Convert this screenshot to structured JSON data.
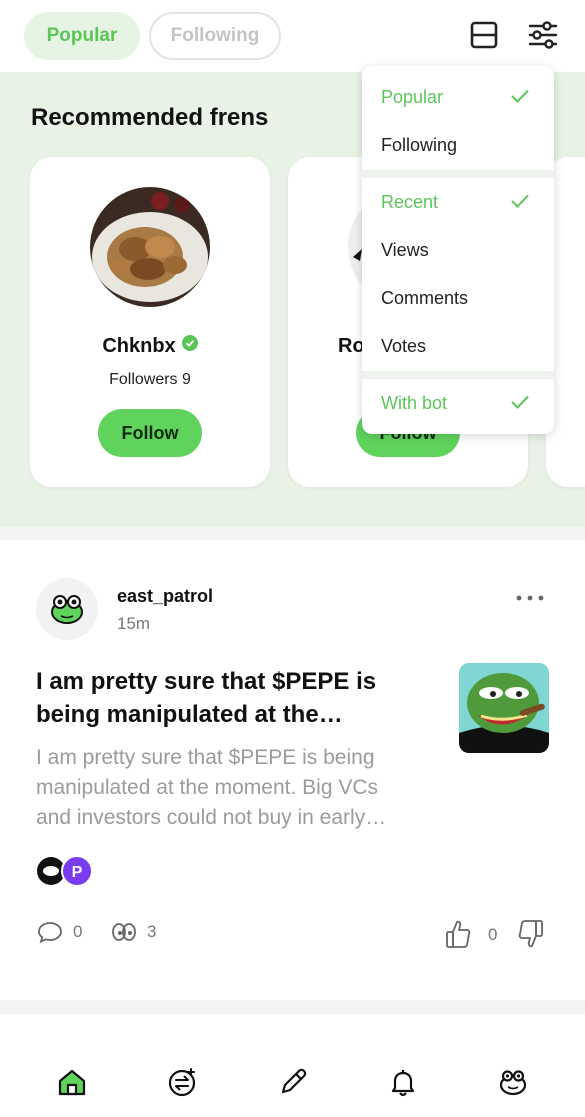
{
  "tabs": {
    "popular": "Popular",
    "following": "Following"
  },
  "icons": {
    "layout": "layout-toggle-icon",
    "filter": "filter-sliders-icon"
  },
  "recommended": {
    "title": "Recommended frens",
    "cards": [
      {
        "name": "Chkn​bx",
        "followers": "Followers 9",
        "button": "Follow",
        "verified": true
      },
      {
        "name": "Ro",
        "button": "Follow"
      }
    ]
  },
  "dropdown": {
    "sort_group": [
      {
        "label": "Popular",
        "selected": true
      },
      {
        "label": "Following",
        "selected": false
      }
    ],
    "order_group": [
      {
        "label": "Recent",
        "selected": true
      },
      {
        "label": "Views",
        "selected": false
      },
      {
        "label": "Comments",
        "selected": false
      },
      {
        "label": "Votes",
        "selected": false
      }
    ],
    "bot_group": [
      {
        "label": "With bot",
        "selected": true
      }
    ]
  },
  "post": {
    "username": "east_patrol",
    "time": "15m",
    "title": "I am pretty sure that $PEPE is being manipulated at the…",
    "body": "I am pretty sure that $PEPE is being manipulated at the moment. Big VCs and investors could not buy in early…",
    "comments": "0",
    "views": "3",
    "votes": "0"
  },
  "nav": [
    "home",
    "swap",
    "write",
    "notifications",
    "profile"
  ],
  "colors": {
    "accent": "#5cc55a",
    "button": "#5fd35c",
    "section_bg": "#e8f3e6"
  }
}
